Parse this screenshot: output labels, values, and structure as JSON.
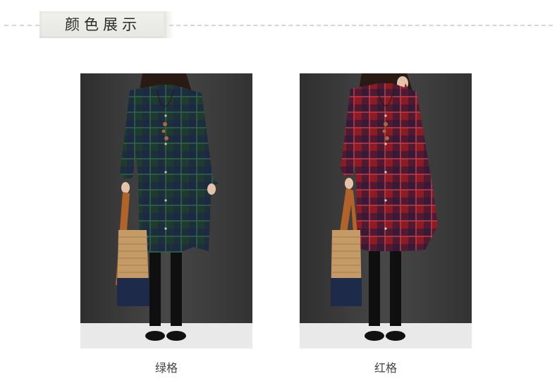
{
  "header": {
    "title": "颜色展示"
  },
  "products": [
    {
      "caption": "绿格",
      "dress_color": "#1f3b2e",
      "check_color": "#2a5a3f",
      "stripe_color": "#1b2446"
    },
    {
      "caption": "红格",
      "dress_color": "#8e1a22",
      "check_color": "#b02a33",
      "stripe_color": "#241a3c"
    }
  ],
  "colors": {
    "backdrop": "#3e3e3e",
    "floor": "#e9e9e9",
    "caption_text": "#444444"
  }
}
